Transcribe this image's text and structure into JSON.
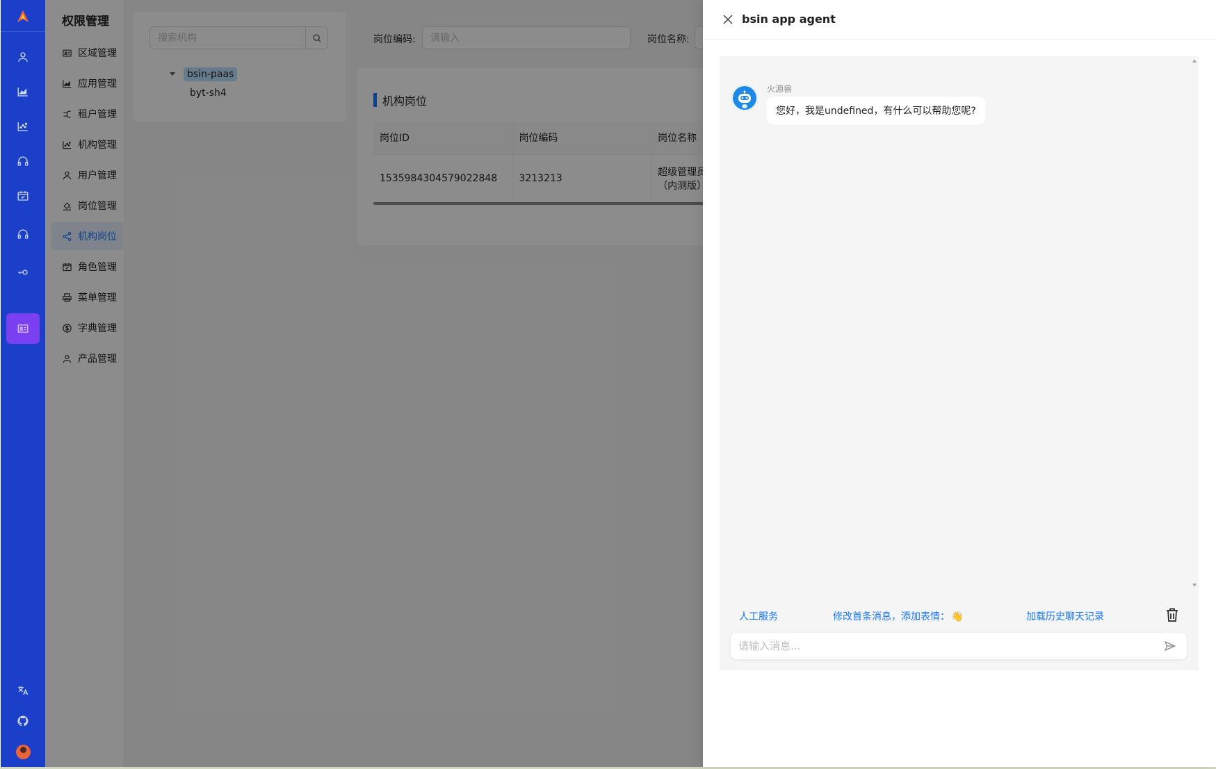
{
  "sidebar": {
    "icons": [
      "user-icon",
      "area-chart-icon",
      "scatter-chart-icon",
      "headset-icon",
      "calendar-check-icon",
      "headset-icon",
      "key-icon",
      "id-card-icon"
    ],
    "bottom_icons": [
      "translate-icon",
      "github-icon",
      "avatar"
    ]
  },
  "menu": {
    "title": "权限管理",
    "items": [
      {
        "label": "区域管理",
        "icon": "id-card-icon"
      },
      {
        "label": "应用管理",
        "icon": "area-chart-icon"
      },
      {
        "label": "租户管理",
        "icon": "branch-icon"
      },
      {
        "label": "机构管理",
        "icon": "scatter-chart-icon"
      },
      {
        "label": "用户管理",
        "icon": "user-icon"
      },
      {
        "label": "岗位管理",
        "icon": "bucket-icon"
      },
      {
        "label": "机构岗位",
        "icon": "share-icon",
        "active": true
      },
      {
        "label": "角色管理",
        "icon": "calendar-check-icon"
      },
      {
        "label": "菜单管理",
        "icon": "printer-icon"
      },
      {
        "label": "字典管理",
        "icon": "dollar-icon"
      },
      {
        "label": "产品管理",
        "icon": "user-icon"
      }
    ]
  },
  "tree": {
    "search_placeholder": "搜索机构",
    "root": "bsin-paas",
    "children": [
      "byt-sh4"
    ]
  },
  "filters": {
    "code_label": "岗位编码:",
    "code_placeholder": "请输入",
    "name_label": "岗位名称:"
  },
  "table": {
    "title": "机构岗位",
    "columns": [
      "岗位ID",
      "岗位编码",
      "岗位名称"
    ],
    "rows": [
      {
        "id": "1535984304579022848",
        "code": "3213213",
        "name": "超级管理员（内测版）"
      }
    ]
  },
  "drawer": {
    "title": "bsin app agent",
    "bot_name": "火源兽",
    "bot_message": "您好，我是undefined，有什么可以帮助您呢?",
    "links": {
      "human": "人工服务",
      "edit_first": "修改首条消息，添加表情：",
      "edit_emoji": "👋",
      "load_history": "加载历史聊天记录"
    },
    "input_placeholder": "请输入消息..."
  },
  "colors": {
    "rail": "#1c3fc9",
    "rail_active": "#7b3ff2",
    "primary": "#1677ff",
    "mask": "rgba(0,0,0,0.45)"
  }
}
